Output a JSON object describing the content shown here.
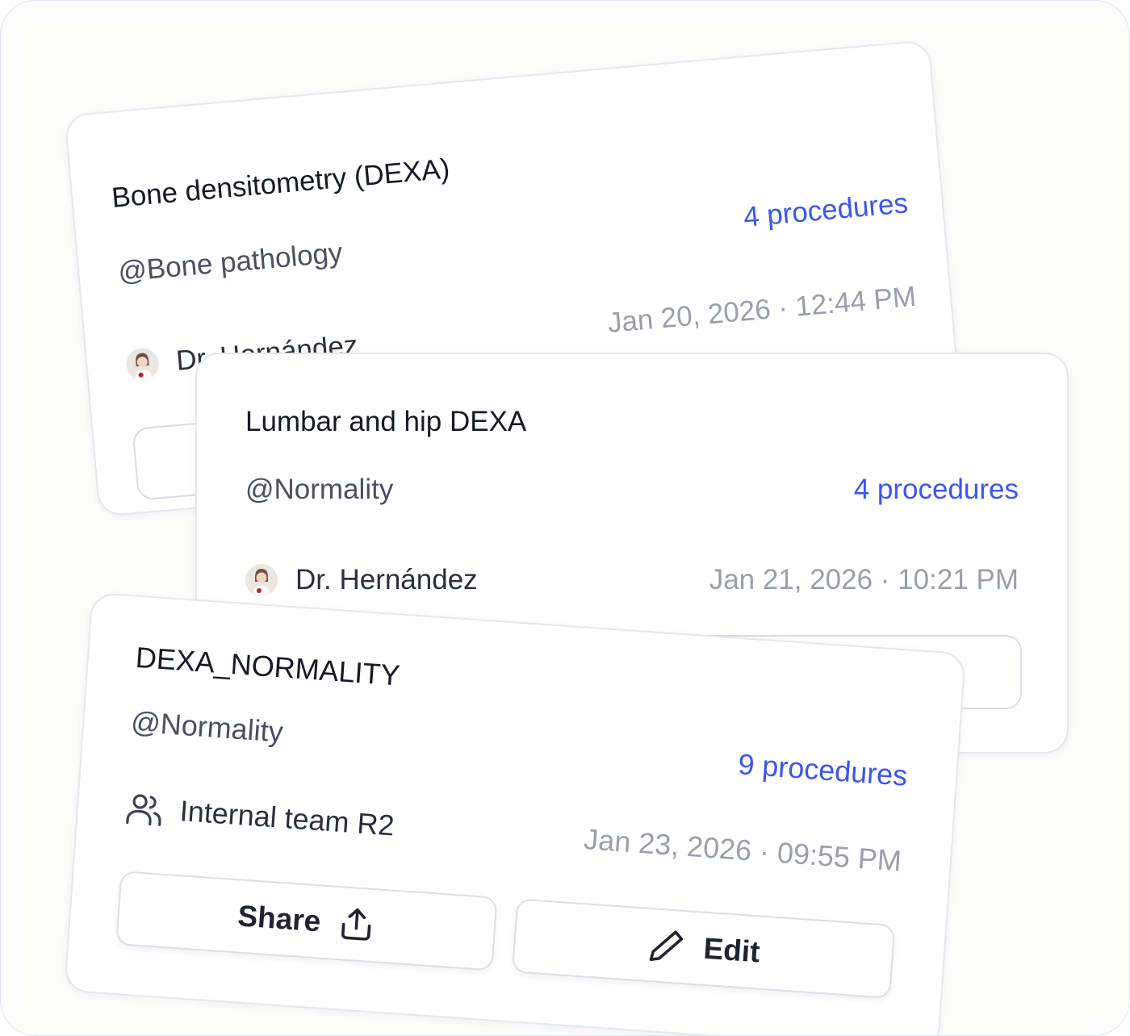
{
  "cards": [
    {
      "title": "Bone densitometry (DEXA)",
      "tag": "@Bone pathology",
      "procedures": "4 procedures",
      "author": "Dr. Hernández",
      "date": "Jan 20, 2026 · 12:44 PM"
    },
    {
      "title": "Lumbar and hip DEXA",
      "tag": "@Normality",
      "procedures": "4 procedures",
      "author": "Dr. Hernández",
      "date": "Jan 21, 2026 · 10:21 PM"
    },
    {
      "title": "DEXA_NORMALITY",
      "tag": "@Normality",
      "procedures": "9 procedures",
      "team": "Internal team R2",
      "date": "Jan 23, 2026 · 09:55 PM",
      "share_label": "Share",
      "edit_label": "Edit"
    }
  ],
  "icons": {
    "avatar": "avatar-icon",
    "team": "users-icon",
    "share": "share-upload-icon",
    "edit": "pencil-icon"
  },
  "colors": {
    "accent": "#3b56f0",
    "title": "#161a28",
    "muted": "#9a9eae",
    "border": "#e6e6ef"
  }
}
